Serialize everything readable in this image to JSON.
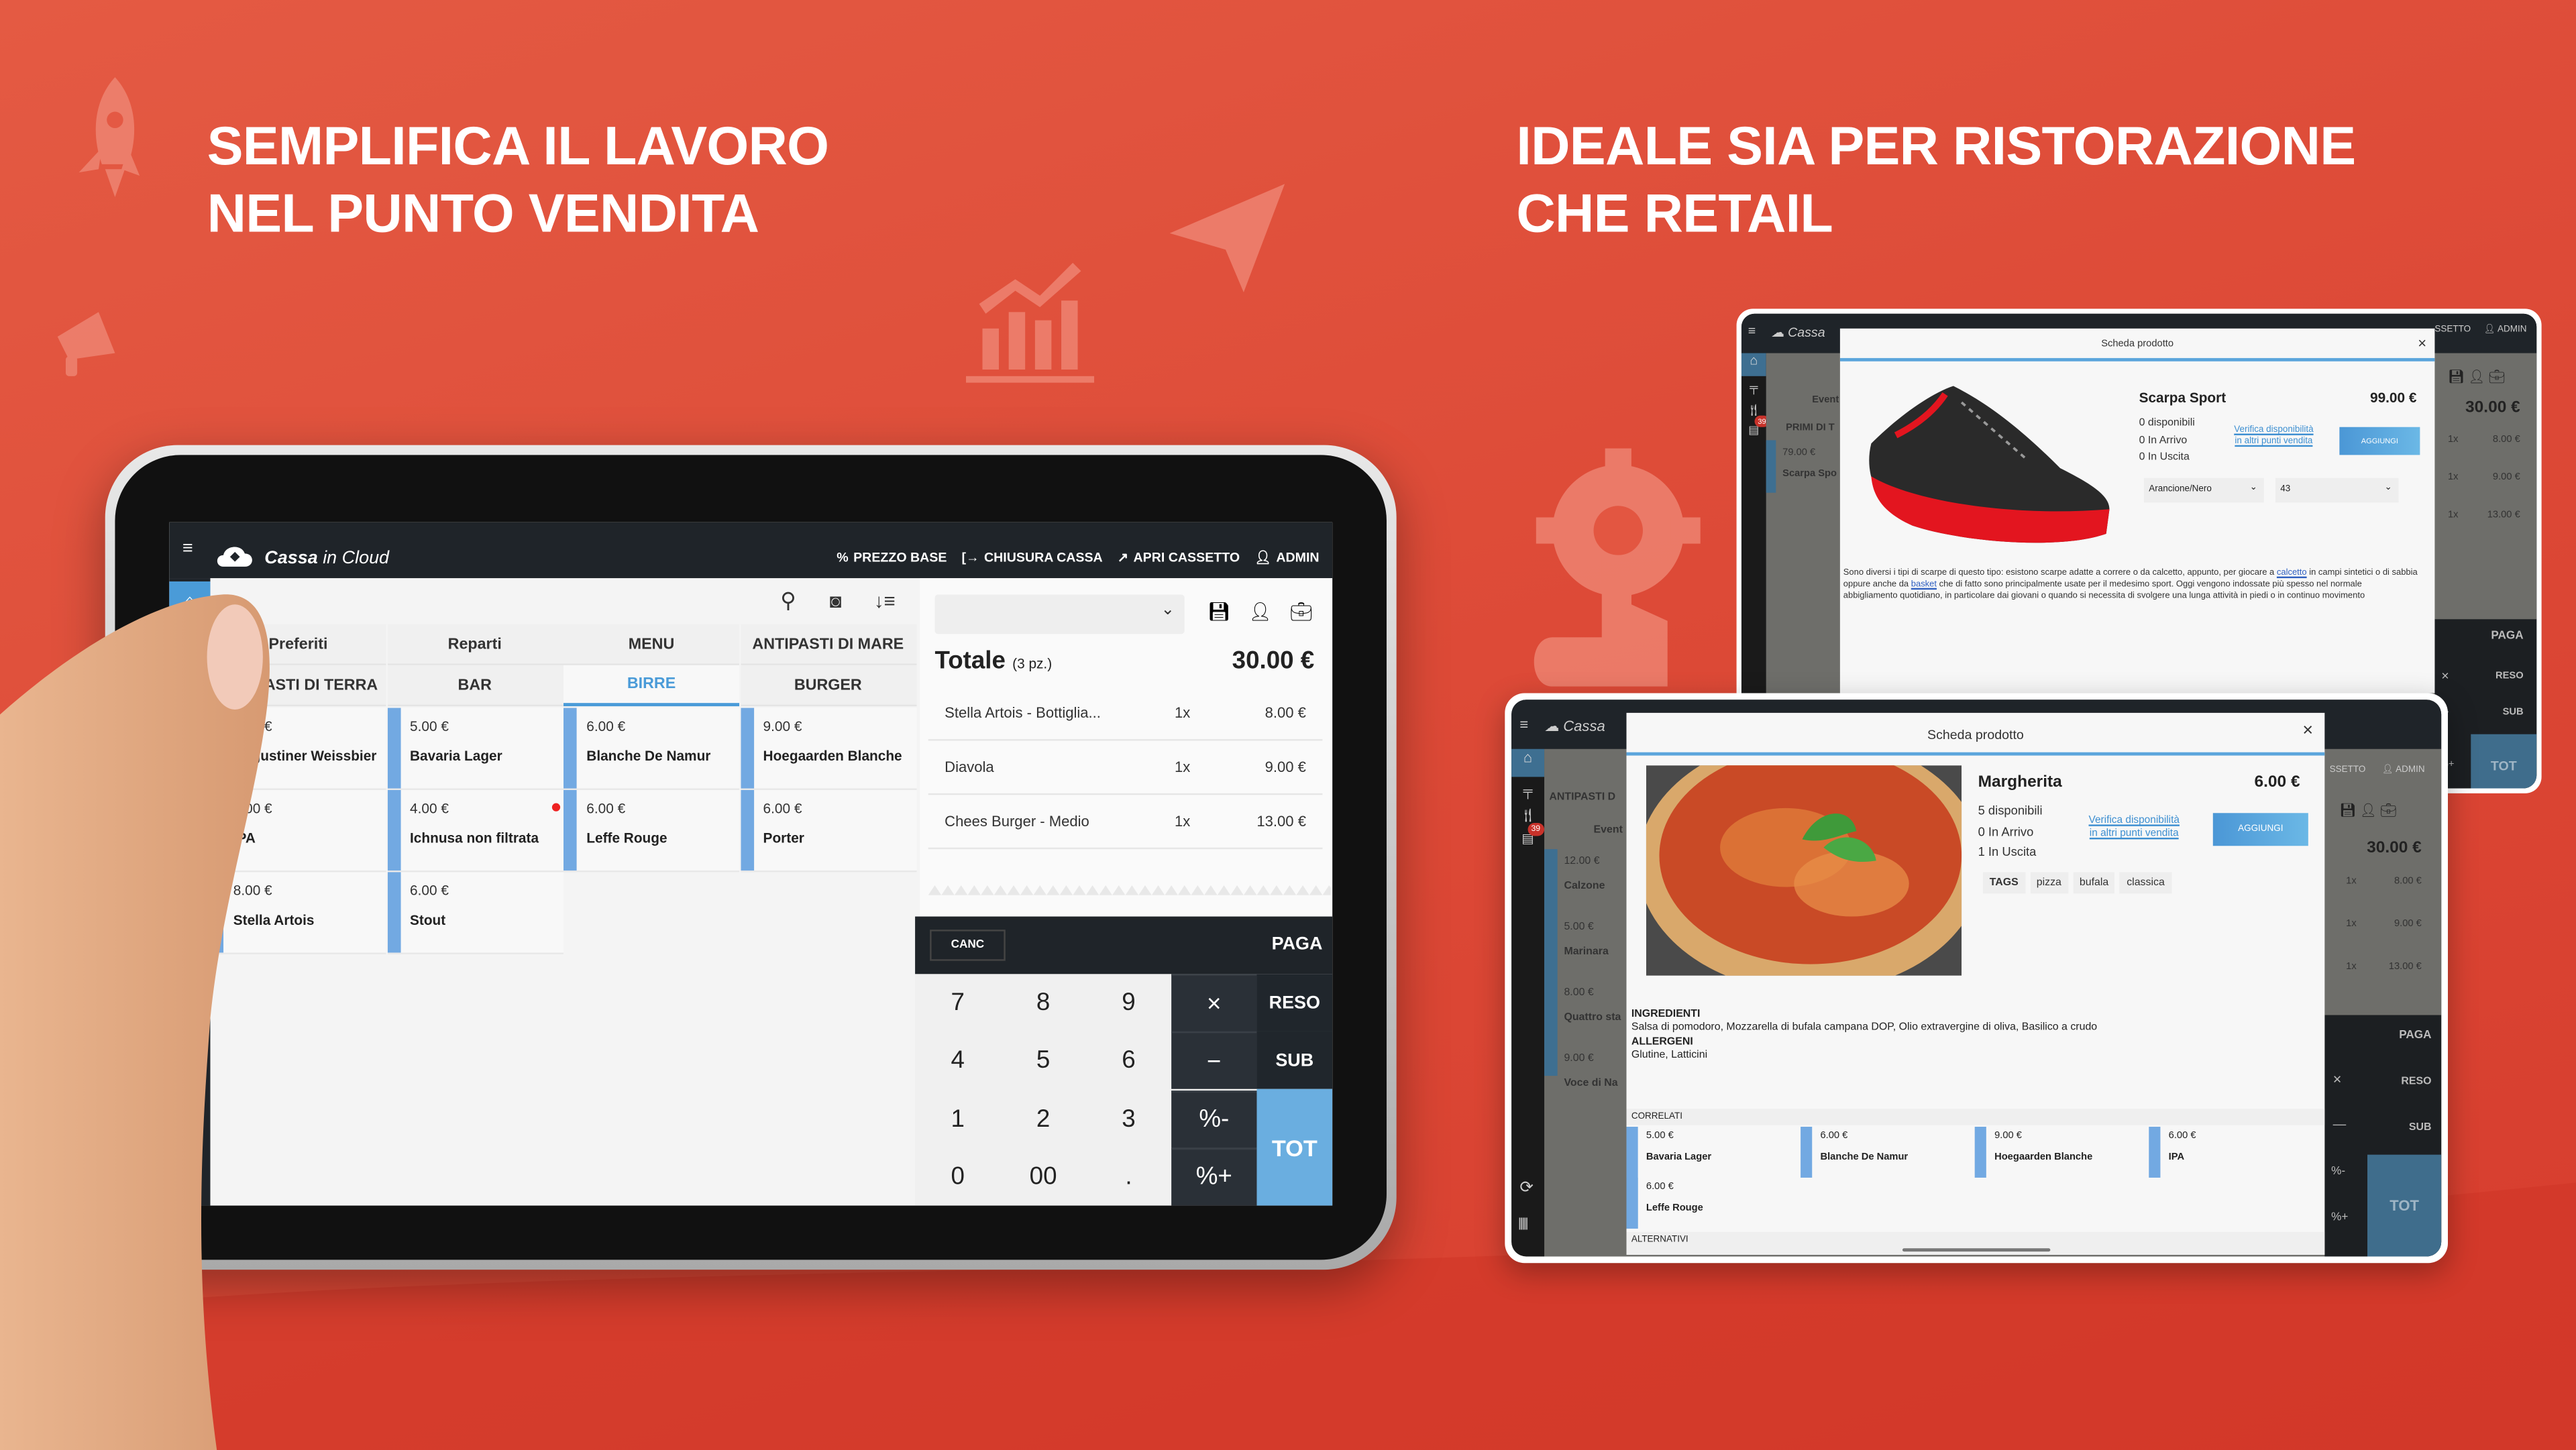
{
  "headings": {
    "left": [
      "SEMPLIFICA IL LAVORO",
      "NEL PUNTO VENDITA"
    ],
    "right": [
      "IDEALE SIA PER RISTORAZIONE",
      "CHE RETAIL"
    ]
  },
  "colors": {
    "background": "#dd4a37",
    "accent_blue": "#5ba5dc",
    "header_dark": "#1f2429",
    "tot_blue": "#6aaee0"
  },
  "main_pos": {
    "app_name": "Cassa",
    "app_name_suffix": "in Cloud",
    "header_actions": [
      "PREZZO BASE",
      "CHIUSURA CASSA",
      "APRI CASSETTO",
      "ADMIN"
    ],
    "tabs_row1": [
      "Preferiti",
      "Reparti",
      "MENU",
      "ANTIPASTI DI MARE"
    ],
    "tabs_row2": [
      "ANTIPASTI DI TERRA",
      "BAR",
      "BIRRE",
      "BURGER"
    ],
    "active_tab": "BIRRE",
    "products": [
      [
        {
          "price": "7.00 €",
          "name": "Augustiner Weissbier"
        },
        {
          "price": "6.00 €",
          "name": "IPA"
        },
        {
          "price": "8.00 €",
          "name": "Stella Artois"
        }
      ],
      [
        {
          "price": "5.00 €",
          "name": "Bavaria Lager"
        },
        {
          "price": "4.00 €",
          "name": "Ichnusa non filtrata"
        },
        {
          "price": "6.00 €",
          "name": "Stout"
        }
      ],
      [
        {
          "price": "6.00 €",
          "name": "Blanche De Namur"
        },
        {
          "price": "6.00 €",
          "name": "Leffe Rouge"
        }
      ],
      [
        {
          "price": "9.00 €",
          "name": "Hoegaarden Blanche"
        },
        {
          "price": "6.00 €",
          "name": "Porter"
        }
      ]
    ],
    "cart": {
      "total_label": "Totale",
      "pieces": "(3 pz.)",
      "total": "30.00 €",
      "lines": [
        {
          "name": "Stella Artois - Bottiglia...",
          "qty": "1x",
          "price": "8.00 €"
        },
        {
          "name": "Diavola",
          "qty": "1x",
          "price": "9.00 €"
        },
        {
          "name": "Chees Burger - Medio",
          "qty": "1x",
          "price": "13.00 €"
        }
      ]
    },
    "keypad": {
      "canc": "CANC",
      "paga": "PAGA",
      "digits": [
        "7",
        "8",
        "9",
        "4",
        "5",
        "6",
        "1",
        "2",
        "3",
        "0",
        "00",
        "."
      ],
      "ops": [
        "×",
        "−",
        "%-",
        "%+"
      ],
      "reso": "RESO",
      "sub": "SUB",
      "tot": "TOT"
    }
  },
  "retail_tablet": {
    "app_name": "Cassa",
    "header_right": [
      "SSETTO",
      "ADMIN"
    ],
    "badge": "39",
    "behind": {
      "tab1": "Event",
      "tab2": "PRIMI DI T",
      "item_price": "79.00 €",
      "item_name": "Scarpa Spo",
      "total": "30.00 €",
      "lines": [
        {
          "qty": "1x",
          "price": "8.00 €"
        },
        {
          "qty": "1x",
          "price": "9.00 €"
        },
        {
          "qty": "1x",
          "price": "13.00 €"
        }
      ],
      "buttons": [
        "PAGA",
        "RESO",
        "SUB",
        "TOT"
      ],
      "ops": [
        "×",
        "−",
        "%+"
      ]
    },
    "modal": {
      "title": "Scheda prodotto",
      "name": "Scarpa Sport",
      "price": "99.00 €",
      "stock": [
        "0 disponibili",
        "0  In Arrivo",
        "0  In Uscita"
      ],
      "link": [
        "Verifica disponibilità",
        "in altri punti vendita"
      ],
      "add": "AGGIUNGI",
      "select_color": "Arancione/Nero",
      "select_size": "43",
      "description": [
        "Sono diversi i tipi di scarpe di questo tipo: esistono scarpe adatte a correre o da calcetto, appunto, per giocare a ",
        "calcetto",
        " in campi sintetici o di sabbia oppure anche da ",
        "basket",
        " che di fatto sono principalmente usate per il medesimo sport. Oggi vengono indossate più spesso nel normale abbigliamento quotidiano, in particolare dai giovani o quando si necessita di svolgere una lunga attività in piedi o in continuo movimento"
      ]
    }
  },
  "restaurant_tablet": {
    "app_name": "Cassa",
    "header_right": [
      "SSETTO",
      "ADMIN"
    ],
    "badge": "39",
    "behind": {
      "tab1": "ANTIPASTI D",
      "tab2": "Event",
      "items": [
        {
          "price": "12.00 €",
          "name": "Calzone"
        },
        {
          "price": "5.00 €",
          "name": "Marinara"
        },
        {
          "price": "8.00 €",
          "name": "Quattro sta"
        },
        {
          "price": "9.00 €",
          "name": "Voce di Na"
        }
      ],
      "total": "30.00 €",
      "lines": [
        {
          "qty": "1x",
          "price": "8.00 €"
        },
        {
          "qty": "1x",
          "price": "9.00 €"
        },
        {
          "qty": "1x",
          "price": "13.00 €"
        }
      ],
      "buttons": [
        "PAGA",
        "RESO",
        "SUB",
        "TOT"
      ],
      "ops": [
        "×",
        "—",
        "%-",
        "%+"
      ]
    },
    "modal": {
      "title": "Scheda prodotto",
      "name": "Margherita",
      "price": "6.00 €",
      "stock": [
        "5 disponibili",
        "0  In Arrivo",
        "1  In Uscita"
      ],
      "link": [
        "Verifica disponibilità",
        "in altri punti vendita"
      ],
      "add": "AGGIUNGI",
      "tags_label": "TAGS",
      "tags": [
        "pizza",
        "bufala",
        "classica"
      ],
      "ingredients_label": "INGREDIENTI",
      "ingredients": "Salsa di pomodoro, Mozzarella di bufala campana DOP, Olio extravergine di oliva, Basilico a crudo",
      "allergens_label": "ALLERGENI",
      "allergens": "Glutine, Latticini",
      "related_label": "CORRELATI",
      "related": [
        {
          "price": "5.00 €",
          "name": "Bavaria Lager"
        },
        {
          "price": "6.00 €",
          "name": "Blanche De Namur"
        },
        {
          "price": "9.00 €",
          "name": "Hoegaarden Blanche"
        },
        {
          "price": "6.00 €",
          "name": "IPA"
        },
        {
          "price": "6.00 €",
          "name": "Leffe Rouge"
        }
      ],
      "alternatives_label": "ALTERNATIVI"
    }
  }
}
